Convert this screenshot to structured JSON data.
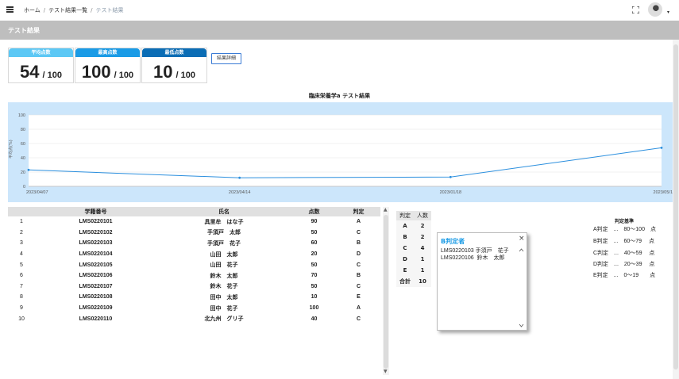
{
  "nav": {
    "breadcrumbs": [
      "ホーム",
      "テスト結果一覧",
      "テスト結果"
    ],
    "separator": "/"
  },
  "header": {
    "title": "テスト結果"
  },
  "cards": [
    {
      "label": "平均点数",
      "value": "54",
      "suffix": "/ 100",
      "color": "#5cc8f5"
    },
    {
      "label": "最高点数",
      "value": "100",
      "suffix": "/ 100",
      "color": "#1a9be6"
    },
    {
      "label": "最低点数",
      "value": "10",
      "suffix": "/ 100",
      "color": "#0b6db5"
    }
  ],
  "detail_button": "結果詳細",
  "chart_data": {
    "type": "line",
    "title": "臨床栄養学a テスト結果",
    "ylabel": "平均点(%)",
    "categories": [
      "2023/04/07",
      "2023/04/14",
      "2023/01/18",
      "2023/05/1"
    ],
    "values": [
      23,
      12,
      13,
      54
    ],
    "ylim": [
      0,
      100
    ],
    "yticks": [
      "0",
      "20",
      "40",
      "60",
      "80",
      "100"
    ],
    "grid": true,
    "line_color": "#2b8fde"
  },
  "table": {
    "headers": [
      "",
      "学籍番号",
      "氏名",
      "点数",
      "判定"
    ],
    "rows": [
      [
        "1",
        "LMS0220101",
        "具里牟　はな子",
        "90",
        "A"
      ],
      [
        "2",
        "LMS0220102",
        "手須戸　太郎",
        "50",
        "C"
      ],
      [
        "3",
        "LMS0220103",
        "手須戸　花子",
        "60",
        "B"
      ],
      [
        "4",
        "LMS0220104",
        "山田　太郎",
        "20",
        "D"
      ],
      [
        "5",
        "LMS0220105",
        "山田　花子",
        "50",
        "C"
      ],
      [
        "6",
        "LMS0220106",
        "鈴木　太郎",
        "70",
        "B"
      ],
      [
        "7",
        "LMS0220107",
        "鈴木　花子",
        "50",
        "C"
      ],
      [
        "8",
        "LMS0220108",
        "田中　太郎",
        "10",
        "E"
      ],
      [
        "9",
        "LMS0220109",
        "田中　花子",
        "100",
        "A"
      ],
      [
        "10",
        "LMS0220110",
        "北九州　グリ子",
        "40",
        "C"
      ]
    ]
  },
  "summary": {
    "headers": [
      "判定",
      "人数"
    ],
    "rows": [
      [
        "A",
        "2"
      ],
      [
        "B",
        "2"
      ],
      [
        "C",
        "4"
      ],
      [
        "D",
        "1"
      ],
      [
        "E",
        "1"
      ],
      [
        "合計",
        "10"
      ]
    ]
  },
  "popup": {
    "title": "B判定者",
    "close": "×",
    "entries": "LMS0220103 手須戸　花子\nLMS0220106  鈴木　太郎"
  },
  "criteria": {
    "title": "判定基準",
    "lines": [
      "A判定　...　80〜100　点",
      "B判定　...　60〜79　 点",
      "C判定　...　40〜59　 点",
      "D判定　...　20〜39　 点",
      "E判定　...　0〜19　　点"
    ]
  }
}
